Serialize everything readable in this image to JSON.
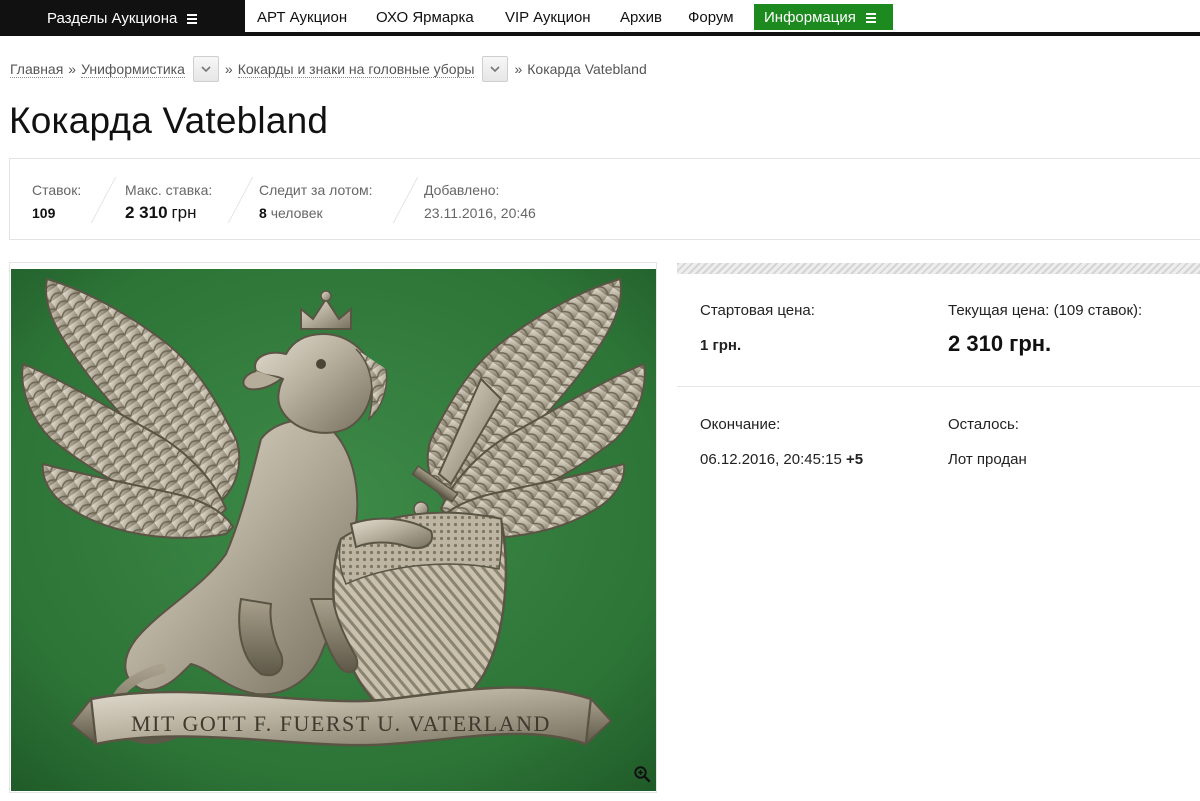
{
  "nav": {
    "sections_label": "Разделы Аукциона",
    "links": [
      "АРТ Аукцион",
      "ОХО Ярмарка",
      "VIP Аукцион",
      "Архив",
      "Форум"
    ],
    "info_label": "Информация"
  },
  "breadcrumb": {
    "home": "Главная",
    "sep": "»",
    "level1": "Униформистика",
    "level2": "Кокарды и знаки на головные уборы",
    "current": "Кокарда Vatebland"
  },
  "title": "Кокарда Vatebland",
  "stats": {
    "bids_label": "Ставок:",
    "bids_value": "109",
    "max_bid_label": "Макс. ставка:",
    "max_bid_value": "2 310",
    "max_bid_unit": "грн",
    "watchers_label": "Следит за лотом:",
    "watchers_value": "8",
    "watchers_unit": "человек",
    "added_label": "Добавлено:",
    "added_value": "23.11.2016, 20:46"
  },
  "price": {
    "start_label": "Стартовая цена:",
    "start_value": "1 грн.",
    "current_label": "Текущая цена: (109 ставок):",
    "current_value": "2 310 грн.",
    "end_label": "Окончание:",
    "end_value": "06.12.2016, 20:45:15",
    "end_tz": "+5",
    "remaining_label": "Осталось:",
    "remaining_value": "Лот продан"
  },
  "photo": {
    "ribbon_text": "MIT GOTT  F. FUERST U.  VATERLAND"
  },
  "colors": {
    "accent_green": "#1c8a1f",
    "nav_dark": "#111111",
    "photo_background": "#2e7a3a"
  },
  "icons": {
    "menu": "hamburger-icon",
    "dropdown": "chevron-down-icon",
    "zoom": "magnifier-plus-icon"
  }
}
